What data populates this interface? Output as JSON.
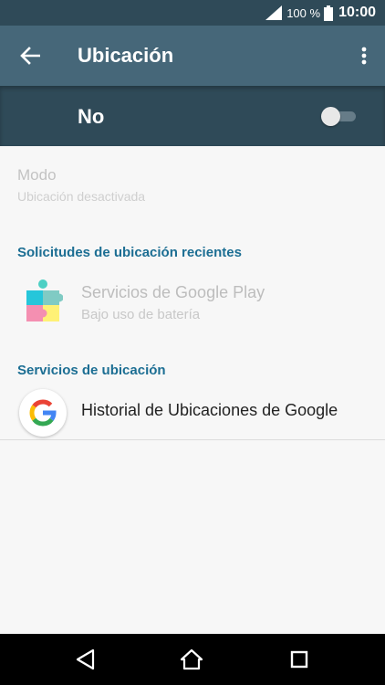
{
  "status_bar": {
    "battery_pct": "100 %",
    "time": "10:00",
    "icons": [
      "signal-icon",
      "battery-icon"
    ]
  },
  "app_bar": {
    "title": "Ubicación",
    "icons": [
      "back-arrow-icon",
      "more-vert-icon"
    ]
  },
  "master_switch": {
    "label": "No",
    "state": "off"
  },
  "mode": {
    "title": "Modo",
    "subtitle": "Ubicación desactivada"
  },
  "recent_requests": {
    "header": "Solicitudes de ubicación recientes",
    "items": [
      {
        "name": "Servicios de Google Play",
        "detail": "Bajo uso de batería",
        "icon": "google-play-services-icon"
      }
    ]
  },
  "location_services": {
    "header": "Servicios de ubicación",
    "items": [
      {
        "name": "Historial de Ubicaciones de Google",
        "icon": "google-g-icon"
      }
    ]
  },
  "nav_bar": {
    "icons": [
      "nav-back-icon",
      "nav-home-icon",
      "nav-recents-icon"
    ]
  },
  "colors": {
    "status_bar": "#2f4a58",
    "app_bar": "#466779",
    "switch_bar": "#2f4a58",
    "section_header": "#1c6e93",
    "background": "#f7f7f7"
  }
}
